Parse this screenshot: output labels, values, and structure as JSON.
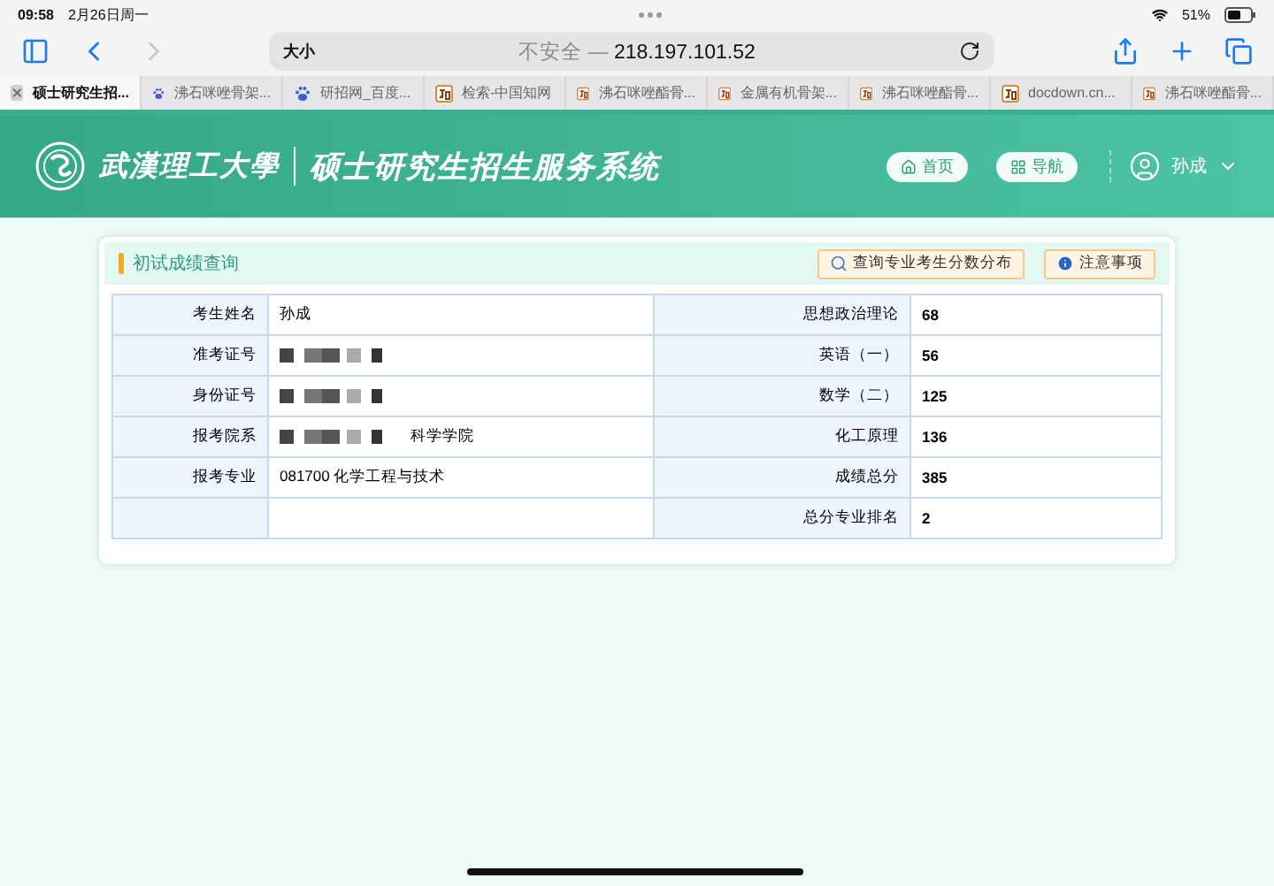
{
  "status_bar": {
    "time": "09:58",
    "date": "2月26日周一",
    "battery": "51%"
  },
  "address_bar": {
    "text_size": "大小",
    "security": "不安全 —",
    "host": "218.197.101.52"
  },
  "tabs": [
    {
      "title": "硕士研究生招...",
      "selected": true,
      "kind": "close"
    },
    {
      "title": "沸石咪唑骨架...",
      "selected": false,
      "kind": "paw"
    },
    {
      "title": "研招网_百度...",
      "selected": false,
      "kind": "paw"
    },
    {
      "title": "检索-中国知网",
      "selected": false,
      "kind": "site"
    },
    {
      "title": "沸石咪唑酯骨...",
      "selected": false,
      "kind": "site"
    },
    {
      "title": "金属有机骨架...",
      "selected": false,
      "kind": "site"
    },
    {
      "title": "沸石咪唑酯骨...",
      "selected": false,
      "kind": "site"
    },
    {
      "title": "docdown.cn...",
      "selected": false,
      "kind": "site"
    },
    {
      "title": "沸石咪唑酯骨...",
      "selected": false,
      "kind": "site"
    }
  ],
  "header": {
    "logo_text": "武漢理工大學",
    "system_title": "硕士研究生招生服务系统",
    "nav": [
      {
        "label": "首页",
        "kind": "home"
      },
      {
        "label": "导航",
        "kind": "grid"
      }
    ],
    "user": "孙成"
  },
  "card": {
    "title": "初试成绩查询",
    "buttons": [
      {
        "label": "查询专业考生分数分布",
        "kind": "search"
      },
      {
        "label": "注意事项",
        "kind": "info"
      }
    ],
    "rows": [
      {
        "label": "考生姓名",
        "value": "孙成",
        "redacted": false,
        "score_label": "思想政治理论",
        "score": "68"
      },
      {
        "label": "准考证号",
        "redacted": true,
        "score_label": "英语（一）",
        "score": "56"
      },
      {
        "label": "身份证号",
        "redacted": true,
        "score_label": "数学（二）",
        "score": "125"
      },
      {
        "label": "报考院系",
        "value": "科学学院",
        "redacted": true,
        "score_label": "化工原理",
        "score": "136"
      },
      {
        "label": "报考专业",
        "value": "081700 化学工程与技术",
        "redacted": false,
        "score_label": "成绩总分",
        "score": "385"
      },
      {
        "redacted": false,
        "score_label": "总分专业排名",
        "score": "2"
      }
    ]
  }
}
